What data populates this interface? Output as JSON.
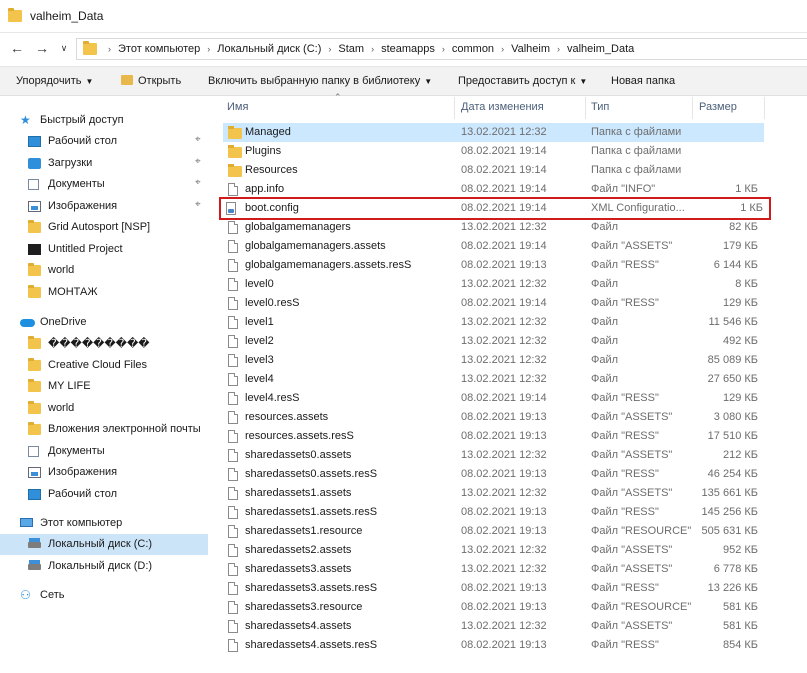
{
  "window": {
    "title": "valheim_Data",
    "icon": "folder-icon"
  },
  "address": {
    "back_icon": "arrow-left-icon",
    "forward_icon": "arrow-right-icon",
    "dropdown_icon": "chevron-down-icon",
    "up_icon": "arrow-up-icon",
    "crumbs": [
      "Этот компьютер",
      "Локальный диск (C:)",
      "Stam",
      "steamapps",
      "common",
      "Valheim",
      "valheim_Data"
    ]
  },
  "toolbar": {
    "organize": "Упорядочить",
    "open": "Открыть",
    "include_library": "Включить выбранную папку в библиотеку",
    "share": "Предоставить доступ к",
    "new_folder": "Новая папка"
  },
  "nav": {
    "quick_access": "Быстрый доступ",
    "quick_items": [
      {
        "label": "Рабочий стол",
        "icon": "desktop-icon",
        "pinned": true
      },
      {
        "label": "Загрузки",
        "icon": "download-icon",
        "pinned": true
      },
      {
        "label": "Документы",
        "icon": "documents-icon",
        "pinned": true
      },
      {
        "label": "Изображения",
        "icon": "images-icon",
        "pinned": true
      },
      {
        "label": "Grid Autosport [NSP]",
        "icon": "folder-icon",
        "pinned": false
      },
      {
        "label": "Untitled Project",
        "icon": "project-icon",
        "pinned": false
      },
      {
        "label": "world",
        "icon": "folder-icon",
        "pinned": false
      },
      {
        "label": "МОНТАЖ",
        "icon": "folder-icon",
        "pinned": false
      }
    ],
    "onedrive": "OneDrive",
    "onedrive_items": [
      {
        "label": "���������",
        "icon": "folder-icon"
      },
      {
        "label": "Creative Cloud Files",
        "icon": "folder-icon"
      },
      {
        "label": "MY LIFE",
        "icon": "folder-icon"
      },
      {
        "label": "world",
        "icon": "folder-icon"
      },
      {
        "label": "Вложения электронной почты",
        "icon": "folder-icon"
      },
      {
        "label": "Документы",
        "icon": "documents-icon"
      },
      {
        "label": "Изображения",
        "icon": "images-icon"
      },
      {
        "label": "Рабочий стол",
        "icon": "desktop-icon"
      }
    ],
    "this_pc": "Этот компьютер",
    "drives": [
      {
        "label": "Локальный диск (C:)",
        "selected": true
      },
      {
        "label": "Локальный диск (D:)",
        "selected": false
      }
    ],
    "network": "Сеть"
  },
  "columns": {
    "name": "Имя",
    "date": "Дата изменения",
    "type": "Тип",
    "size": "Размер"
  },
  "files": [
    {
      "name": "Managed",
      "date": "13.02.2021 12:32",
      "type": "Папка с файлами",
      "size": "",
      "kind": "folder",
      "selected": true
    },
    {
      "name": "Plugins",
      "date": "08.02.2021 19:14",
      "type": "Папка с файлами",
      "size": "",
      "kind": "folder"
    },
    {
      "name": "Resources",
      "date": "08.02.2021 19:14",
      "type": "Папка с файлами",
      "size": "",
      "kind": "folder"
    },
    {
      "name": "app.info",
      "date": "08.02.2021 19:14",
      "type": "Файл \"INFO\"",
      "size": "1 КБ",
      "kind": "file"
    },
    {
      "name": "boot.config",
      "date": "08.02.2021 19:14",
      "type": "XML Configuratio...",
      "size": "1 КБ",
      "kind": "config",
      "highlight": true
    },
    {
      "name": "globalgamemanagers",
      "date": "13.02.2021 12:32",
      "type": "Файл",
      "size": "82 КБ",
      "kind": "file"
    },
    {
      "name": "globalgamemanagers.assets",
      "date": "08.02.2021 19:14",
      "type": "Файл \"ASSETS\"",
      "size": "179 КБ",
      "kind": "file"
    },
    {
      "name": "globalgamemanagers.assets.resS",
      "date": "08.02.2021 19:13",
      "type": "Файл \"RESS\"",
      "size": "6 144 КБ",
      "kind": "file"
    },
    {
      "name": "level0",
      "date": "13.02.2021 12:32",
      "type": "Файл",
      "size": "8 КБ",
      "kind": "file"
    },
    {
      "name": "level0.resS",
      "date": "08.02.2021 19:14",
      "type": "Файл \"RESS\"",
      "size": "129 КБ",
      "kind": "file"
    },
    {
      "name": "level1",
      "date": "13.02.2021 12:32",
      "type": "Файл",
      "size": "11 546 КБ",
      "kind": "file"
    },
    {
      "name": "level2",
      "date": "13.02.2021 12:32",
      "type": "Файл",
      "size": "492 КБ",
      "kind": "file"
    },
    {
      "name": "level3",
      "date": "13.02.2021 12:32",
      "type": "Файл",
      "size": "85 089 КБ",
      "kind": "file"
    },
    {
      "name": "level4",
      "date": "13.02.2021 12:32",
      "type": "Файл",
      "size": "27 650 КБ",
      "kind": "file"
    },
    {
      "name": "level4.resS",
      "date": "08.02.2021 19:14",
      "type": "Файл \"RESS\"",
      "size": "129 КБ",
      "kind": "file"
    },
    {
      "name": "resources.assets",
      "date": "08.02.2021 19:13",
      "type": "Файл \"ASSETS\"",
      "size": "3 080 КБ",
      "kind": "file"
    },
    {
      "name": "resources.assets.resS",
      "date": "08.02.2021 19:13",
      "type": "Файл \"RESS\"",
      "size": "17 510 КБ",
      "kind": "file"
    },
    {
      "name": "sharedassets0.assets",
      "date": "13.02.2021 12:32",
      "type": "Файл \"ASSETS\"",
      "size": "212 КБ",
      "kind": "file"
    },
    {
      "name": "sharedassets0.assets.resS",
      "date": "08.02.2021 19:13",
      "type": "Файл \"RESS\"",
      "size": "46 254 КБ",
      "kind": "file"
    },
    {
      "name": "sharedassets1.assets",
      "date": "13.02.2021 12:32",
      "type": "Файл \"ASSETS\"",
      "size": "135 661 КБ",
      "kind": "file"
    },
    {
      "name": "sharedassets1.assets.resS",
      "date": "08.02.2021 19:13",
      "type": "Файл \"RESS\"",
      "size": "145 256 КБ",
      "kind": "file"
    },
    {
      "name": "sharedassets1.resource",
      "date": "08.02.2021 19:13",
      "type": "Файл \"RESOURCE\"",
      "size": "505 631 КБ",
      "kind": "file"
    },
    {
      "name": "sharedassets2.assets",
      "date": "13.02.2021 12:32",
      "type": "Файл \"ASSETS\"",
      "size": "952 КБ",
      "kind": "file"
    },
    {
      "name": "sharedassets3.assets",
      "date": "13.02.2021 12:32",
      "type": "Файл \"ASSETS\"",
      "size": "6 778 КБ",
      "kind": "file"
    },
    {
      "name": "sharedassets3.assets.resS",
      "date": "08.02.2021 19:13",
      "type": "Файл \"RESS\"",
      "size": "13 226 КБ",
      "kind": "file"
    },
    {
      "name": "sharedassets3.resource",
      "date": "08.02.2021 19:13",
      "type": "Файл \"RESOURCE\"",
      "size": "581 КБ",
      "kind": "file"
    },
    {
      "name": "sharedassets4.assets",
      "date": "13.02.2021 12:32",
      "type": "Файл \"ASSETS\"",
      "size": "581 КБ",
      "kind": "file"
    },
    {
      "name": "sharedassets4.assets.resS",
      "date": "08.02.2021 19:13",
      "type": "Файл \"RESS\"",
      "size": "854 КБ",
      "kind": "file"
    }
  ],
  "colors": {
    "selection": "#cce8ff",
    "nav_selection": "#cce4f7",
    "highlight_border": "#d11a1a",
    "folder": "#f2c44c"
  }
}
